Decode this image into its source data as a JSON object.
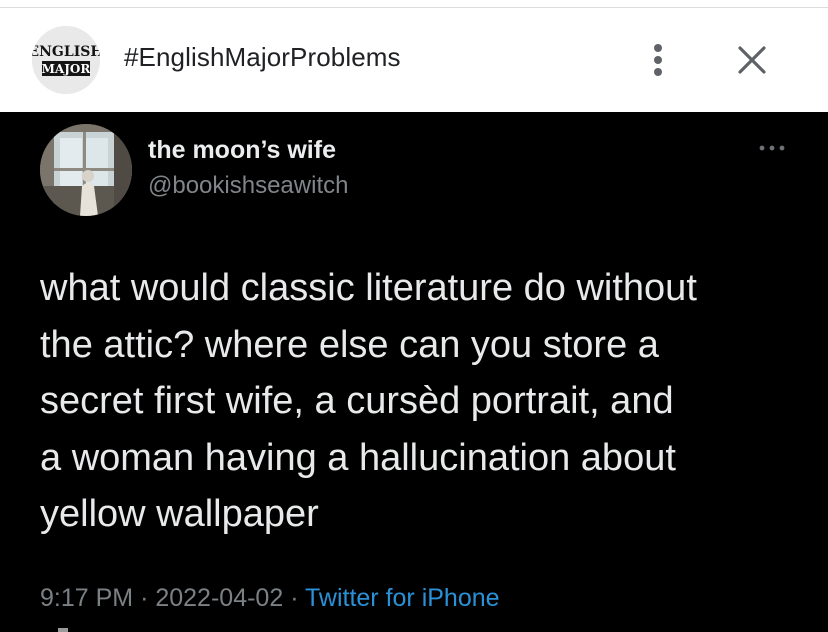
{
  "header": {
    "group_avatar_text_line1": "ENGLISH",
    "group_avatar_text_line2": "MAJOR",
    "title": "#EnglishMajorProblems",
    "more_icon": "more-vertical-icon",
    "close_icon": "close-icon"
  },
  "tweet": {
    "display_name": "the moon’s wife",
    "handle": "@bookishseawitch",
    "more_icon": "more-horizontal-icon",
    "text_lines": [
      "what would classic literature do without",
      "the attic? where else can you store a",
      "secret first wife, a cursèd portrait, and",
      "a woman having a hallucination about",
      "yellow wallpaper"
    ],
    "time": "9:17 PM",
    "separator": "·",
    "date": "2022-04-02",
    "source": "Twitter for iPhone"
  },
  "colors": {
    "tweet_background": "#000000",
    "tweet_text": "#e8e9ea",
    "muted_text": "#7b8084",
    "link": "#2a91d7",
    "header_background": "#ffffff",
    "header_title": "#202124"
  }
}
